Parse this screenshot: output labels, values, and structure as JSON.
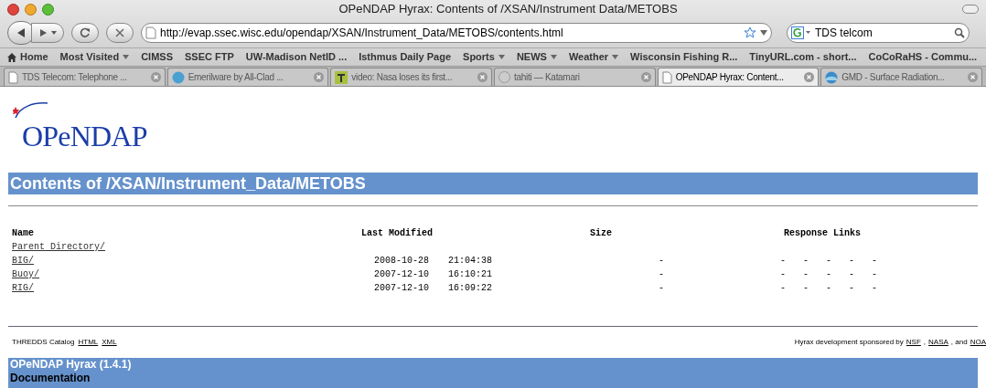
{
  "window": {
    "title": "OPeNDAP Hyrax: Contents of /XSAN/Instrument Data/METOBS"
  },
  "toolbar": {
    "url": "http://evap.ssec.wisc.edu/opendap/XSAN/Instrument_Data/METOBS/contents.html",
    "search_value": "TDS telcom"
  },
  "bookmarks": [
    {
      "label": "Home",
      "kind": "home"
    },
    {
      "label": "Most Visited",
      "kind": "menu"
    },
    {
      "label": "CIMSS",
      "kind": "link"
    },
    {
      "label": "SSEC FTP",
      "kind": "link"
    },
    {
      "label": "UW-Madison NetID ...",
      "kind": "link"
    },
    {
      "label": "Isthmus Daily Page",
      "kind": "link"
    },
    {
      "label": "Sports",
      "kind": "menu"
    },
    {
      "label": "NEWS",
      "kind": "menu"
    },
    {
      "label": "Weather",
      "kind": "menu"
    },
    {
      "label": "Wisconsin Fishing R...",
      "kind": "link"
    },
    {
      "label": "TinyURL.com - short...",
      "kind": "link"
    },
    {
      "label": "CoCoRaHS - Commu...",
      "kind": "link"
    }
  ],
  "tabs": [
    {
      "label": "TDS Telecom: Telephone ...",
      "kind": "page",
      "selected": false
    },
    {
      "label": "Emerilware by All-Clad ...",
      "kind": "circle",
      "selected": false
    },
    {
      "label": "video: Nasa loses its first...",
      "kind": "letter",
      "selected": false
    },
    {
      "label": "tahiti — Katamari",
      "kind": "disc",
      "selected": false
    },
    {
      "label": "OPeNDAP Hyrax: Content...",
      "kind": "page",
      "selected": true
    },
    {
      "label": "GMD - Surface Radiation...",
      "kind": "globe",
      "selected": false
    }
  ],
  "page": {
    "logo": "OPeNDAP",
    "heading": "Contents of /XSAN/Instrument_Data/METOBS",
    "columns": [
      "Name",
      "Last Modified",
      "Size",
      "Response Links"
    ],
    "rows": [
      {
        "name": "Parent Directory/"
      },
      {
        "name": "BIG/",
        "date": "2008-10-28",
        "time": "21:04:38",
        "size": "-",
        "links": [
          "-",
          "-",
          "-",
          "-",
          "-"
        ]
      },
      {
        "name": "Buoy/",
        "date": "2007-12-10",
        "time": "16:10:21",
        "size": "-",
        "links": [
          "-",
          "-",
          "-",
          "-",
          "-"
        ]
      },
      {
        "name": "RIG/",
        "date": "2007-12-10",
        "time": "16:09:22",
        "size": "-",
        "links": [
          "-",
          "-",
          "-",
          "-",
          "-"
        ]
      }
    ],
    "footer": {
      "catalog_label": "THREDDS Catalog",
      "catalog_links": [
        "HTML",
        "XML"
      ],
      "sponsor_text": "Hyrax development sponsored by",
      "sponsors": [
        "NSF",
        "NASA",
        "NOA"
      ],
      "separators": [
        ",",
        ", and"
      ]
    },
    "banner": {
      "title": "OPeNDAP Hyrax (1.4.1)",
      "link": "Documentation"
    }
  }
}
